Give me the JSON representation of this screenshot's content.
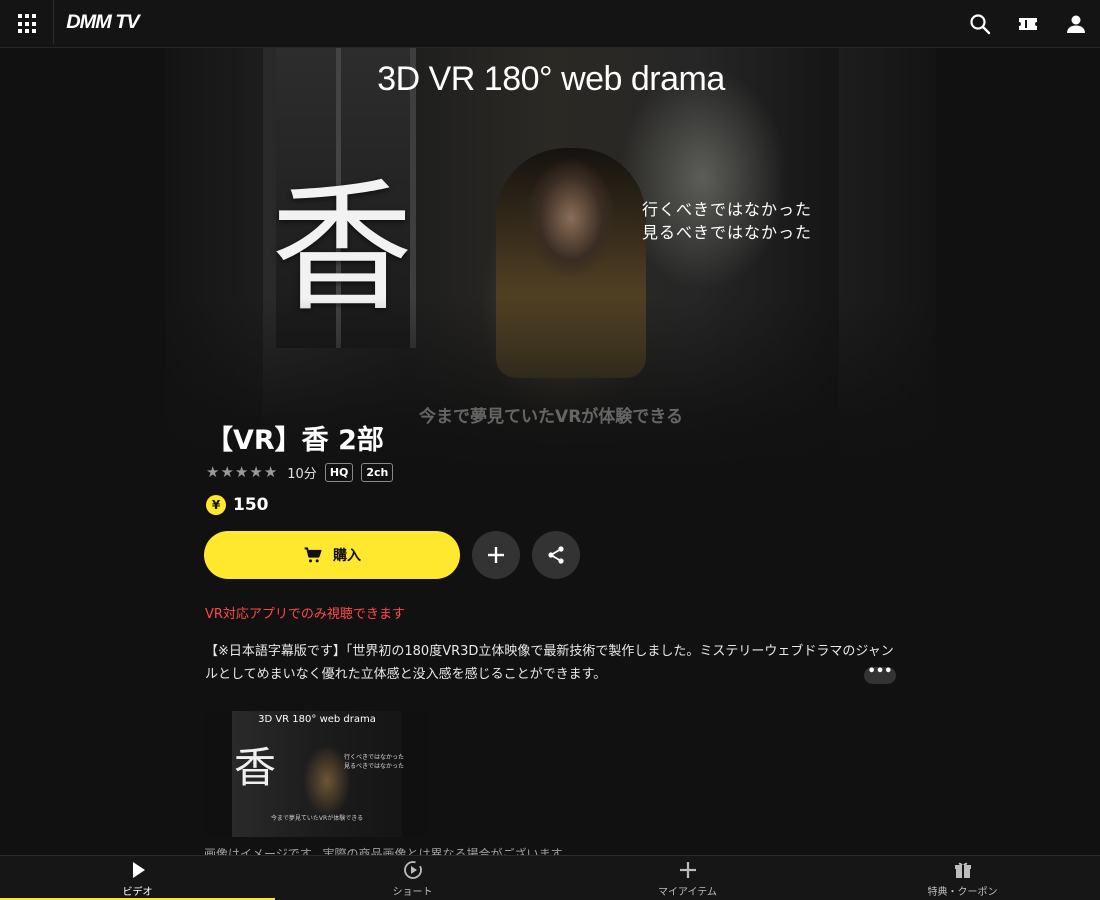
{
  "header": {
    "logo": "DMM TV",
    "icons": [
      "grid-menu-icon",
      "search-icon",
      "ticket-icon",
      "user-icon"
    ]
  },
  "hero": {
    "title": "3D VR 180° web drama",
    "kanji": "香",
    "tagline_line1": "行くべきではなかった",
    "tagline_line2": "見るべきではなかった",
    "caption": "今まで夢見ていたVRが体験できる"
  },
  "product": {
    "title": "【VR】香 2部",
    "rating_stars": 5,
    "duration": "10分",
    "badges": [
      "HQ",
      "2ch"
    ],
    "currency_symbol": "¥",
    "price": "150",
    "buy_label": "購入",
    "notice": "VR対応アプリでのみ視聴できます",
    "description": "【※日本語字幕版です】「世界初の180度VR3D立体映像で最新技術で製作しました。ミステリーウェブドラマのジャンルとしてめまいなく優れた立体感と没入感を感じることができます。",
    "more_label": "•••"
  },
  "thumbnail": {
    "title": "3D VR 180° web drama",
    "kanji": "香",
    "tagline_line1": "行くべきではなかった",
    "tagline_line2": "見るべきではなかった",
    "caption": "今まで夢見ていたVRが体験できる",
    "note": "画像はイメージです。実際の商品画像とは異なる場合がございます。"
  },
  "bottom_nav": {
    "items": [
      {
        "label": "ビデオ",
        "icon": "play-icon",
        "active": true
      },
      {
        "label": "ショート",
        "icon": "short-play-icon",
        "active": false
      },
      {
        "label": "マイアイテム",
        "icon": "plus-icon",
        "active": false
      },
      {
        "label": "特典・クーポン",
        "icon": "gift-icon",
        "active": false
      }
    ]
  },
  "colors": {
    "accent": "#ffe82e",
    "background": "#111111",
    "notice": "#ff4a4a"
  }
}
